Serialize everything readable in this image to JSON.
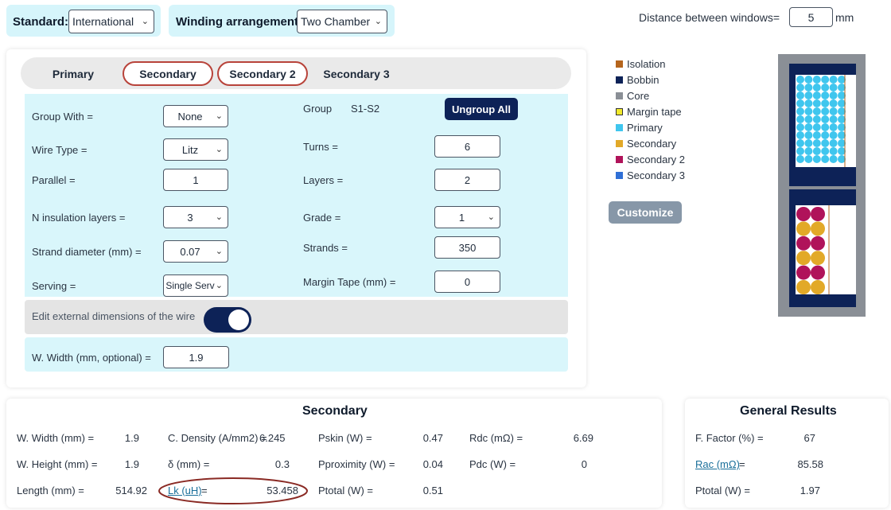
{
  "top": {
    "standard_label": "Standard:",
    "standard_value": "International",
    "winding_label": "Winding arrangement:",
    "winding_value": "Two Chamber",
    "distance_label": "Distance between windows=",
    "distance_value": "5",
    "distance_unit": "mm"
  },
  "tabs": [
    "Primary",
    "Secondary",
    "Secondary 2",
    "Secondary 3"
  ],
  "form": {
    "group_with_label": "Group With =",
    "group_with_value": "None",
    "group_label": "Group",
    "group_value": "S1-S2",
    "ungroup_label": "Ungroup All",
    "wire_type_label": "Wire Type =",
    "wire_type_value": "Litz",
    "turns_label": "Turns =",
    "turns_value": "6",
    "parallel_label": "Parallel =",
    "parallel_value": "1",
    "layers_label": "Layers =",
    "layers_value": "2",
    "n_insulation_label": "N insulation layers =",
    "n_insulation_value": "3",
    "grade_label": "Grade =",
    "grade_value": "1",
    "strand_diameter_label": "Strand diameter (mm) =",
    "strand_diameter_value": "0.07",
    "strands_label": "Strands =",
    "strands_value": "350",
    "serving_label": "Serving =",
    "serving_value": "Single Serv",
    "margin_tape_label": "Margin Tape (mm) =",
    "margin_tape_value": "0",
    "edit_external_label": "Edit external dimensions of the wire",
    "w_width_label": "W. Width (mm, optional) =",
    "w_width_value": "1.9"
  },
  "legend": [
    {
      "label": "Isolation",
      "color": "#b5651d"
    },
    {
      "label": "Bobbin",
      "color": "#0d2257"
    },
    {
      "label": "Core",
      "color": "#8a8f96"
    },
    {
      "label": "Margin tape",
      "color": "#f2ea2b"
    },
    {
      "label": "Primary",
      "color": "#3fc6ee"
    },
    {
      "label": "Secondary",
      "color": "#e2a928"
    },
    {
      "label": "Secondary 2",
      "color": "#b0135a"
    },
    {
      "label": "Secondary 3",
      "color": "#2f6fd6"
    }
  ],
  "customize_label": "Customize",
  "secondary_results": {
    "title": "Secondary",
    "w_width_label": "W. Width (mm) =",
    "w_width_value": "1.9",
    "w_height_label": "W. Height (mm) =",
    "w_height_value": "1.9",
    "length_label": "Length (mm) =",
    "length_value": "514.92",
    "c_density_label": "C. Density (A/mm2) =",
    "c_density_value": "6.245",
    "delta_label": "δ (mm) =",
    "delta_value": "0.3",
    "lk_label": "Lk (uH)",
    "lk_eq": "=",
    "lk_value": "53.458",
    "pskin_label": "Pskin (W) =",
    "pskin_value": "0.47",
    "pprox_label": "Pproximity (W) =",
    "pprox_value": "0.04",
    "ptotal_label": "Ptotal (W) =",
    "ptotal_value": "0.51",
    "rdc_label": "Rdc (mΩ) =",
    "rdc_value": "6.69",
    "pdc_label": "Pdc (W) =",
    "pdc_value": "0"
  },
  "general_results": {
    "title": "General Results",
    "ffactor_label": "F. Factor (%) =",
    "ffactor_value": "67",
    "rac_label": "Rac (mΩ)",
    "rac_eq": "=",
    "rac_value": "85.58",
    "ptotal_label": "Ptotal (W) =",
    "ptotal_value": "1.97"
  }
}
